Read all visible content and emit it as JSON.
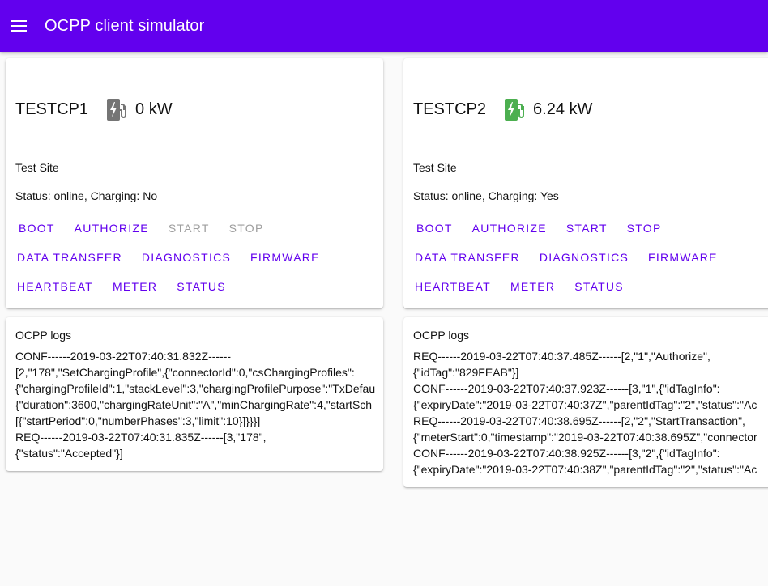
{
  "app": {
    "title": "OCPP client simulator"
  },
  "stations": [
    {
      "name": "TESTCP1",
      "power": "0 kW",
      "charging": false,
      "site": "Test Site",
      "status": "Status: online, Charging: No",
      "buttons": {
        "boot": "BOOT",
        "authorize": "AUTHORIZE",
        "start": "START",
        "stop": "STOP",
        "data_transfer": "DATA TRANSFER",
        "diagnostics": "DIAGNOSTICS",
        "firmware": "FIRMWARE",
        "heartbeat": "HEARTBEAT",
        "meter": "METER",
        "status": "STATUS"
      },
      "logs_title": "OCPP logs",
      "logs": [
        "CONF------2019-03-22T07:40:31.832Z------",
        "[2,\"178\",\"SetChargingProfile\",{\"connectorId\":0,\"csChargingProfiles\":",
        "{\"chargingProfileId\":1,\"stackLevel\":3,\"chargingProfilePurpose\":\"TxDefau",
        "{\"duration\":3600,\"chargingRateUnit\":\"A\",\"minChargingRate\":4,\"startSch",
        "[{\"startPeriod\":0,\"numberPhases\":3,\"limit\":10}]}}}]",
        "REQ------2019-03-22T07:40:31.835Z------[3,\"178\",",
        "{\"status\":\"Accepted\"}]"
      ]
    },
    {
      "name": "TESTCP2",
      "power": "6.24 kW",
      "charging": true,
      "site": "Test Site",
      "status": "Status: online, Charging: Yes",
      "buttons": {
        "boot": "BOOT",
        "authorize": "AUTHORIZE",
        "start": "START",
        "stop": "STOP",
        "data_transfer": "DATA TRANSFER",
        "diagnostics": "DIAGNOSTICS",
        "firmware": "FIRMWARE",
        "heartbeat": "HEARTBEAT",
        "meter": "METER",
        "status": "STATUS"
      },
      "logs_title": "OCPP logs",
      "logs": [
        "REQ------2019-03-22T07:40:37.485Z------[2,\"1\",\"Authorize\",",
        "{\"idTag\":\"829FEAB\"}]",
        "CONF------2019-03-22T07:40:37.923Z------[3,\"1\",{\"idTagInfo\":",
        "{\"expiryDate\":\"2019-03-22T07:40:37Z\",\"parentIdTag\":\"2\",\"status\":\"Ac",
        "REQ------2019-03-22T07:40:38.695Z------[2,\"2\",\"StartTransaction\",",
        "{\"meterStart\":0,\"timestamp\":\"2019-03-22T07:40:38.695Z\",\"connector",
        "CONF------2019-03-22T07:40:38.925Z------[3,\"2\",{\"idTagInfo\":",
        "{\"expiryDate\":\"2019-03-22T07:40:38Z\",\"parentIdTag\":\"2\",\"status\":\"Ac"
      ]
    }
  ],
  "colors": {
    "appbar": "#6200ee",
    "accent": "#6200ee",
    "disabled": "#9e9e9e",
    "icon_idle": "#757575",
    "icon_charging": "#4caf50"
  },
  "icons": {
    "charger": "ev-station-icon",
    "menu": "menu-icon"
  }
}
